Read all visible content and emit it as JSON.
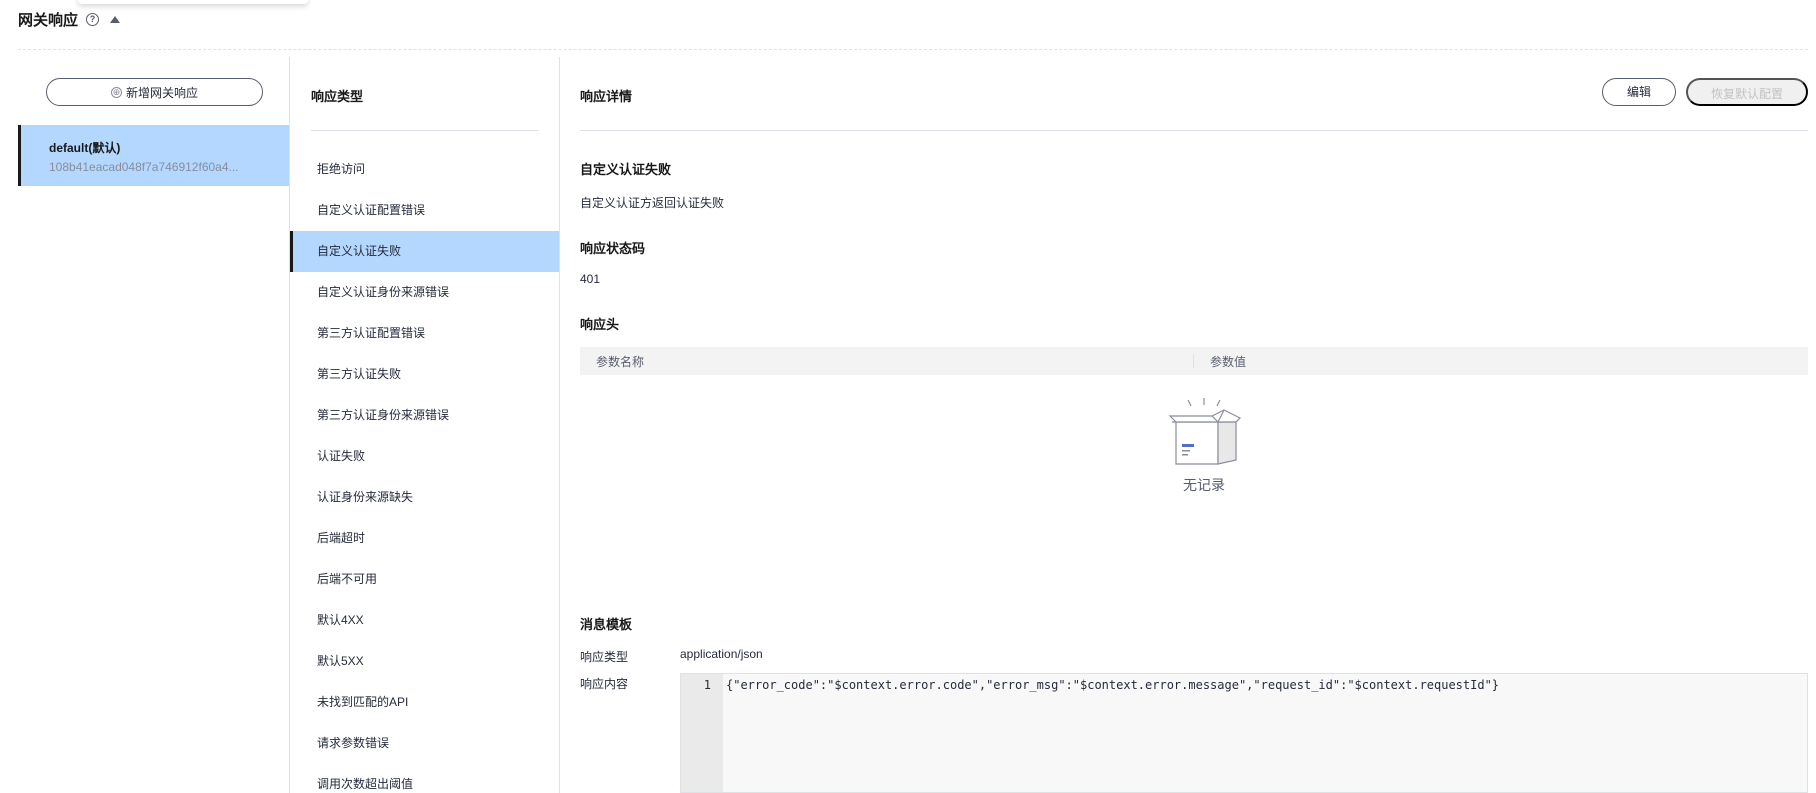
{
  "header": {
    "title": "网关响应",
    "help_icon": "?"
  },
  "left_panel": {
    "add_button_icon": "⊕",
    "add_button_label": "新增网关响应",
    "items": [
      {
        "name": "default(默认)",
        "id": "108b41eacad048f7a746912f60a4..."
      }
    ]
  },
  "middle_panel": {
    "title": "响应类型",
    "types": [
      "拒绝访问",
      "自定义认证配置错误",
      "自定义认证失败",
      "自定义认证身份来源错误",
      "第三方认证配置错误",
      "第三方认证失败",
      "第三方认证身份来源错误",
      "认证失败",
      "认证身份来源缺失",
      "后端超时",
      "后端不可用",
      "默认4XX",
      "默认5XX",
      "未找到匹配的API",
      "请求参数错误",
      "调用次数超出阈值"
    ],
    "active_index": 2
  },
  "detail": {
    "title": "响应详情",
    "edit_label": "编辑",
    "reset_label": "恢复默认配置",
    "name": "自定义认证失败",
    "description": "自定义认证方返回认证失败",
    "status_code_label": "响应状态码",
    "status_code": "401",
    "headers_label": "响应头",
    "headers_columns": [
      "参数名称",
      "参数值"
    ],
    "empty_text": "无记录",
    "template_label": "消息模板",
    "content_type_label": "响应类型",
    "content_type": "application/json",
    "content_label": "响应内容",
    "line_number": "1",
    "content": "{\"error_code\":\"$context.error.code\",\"error_msg\":\"$context.error.message\",\"request_id\":\"$context.requestId\"}"
  },
  "colors": {
    "selected_bg": "#b3d7ff",
    "divider": "#dfe1e6",
    "text": "#252b3a",
    "muted": "#8a8e99"
  }
}
